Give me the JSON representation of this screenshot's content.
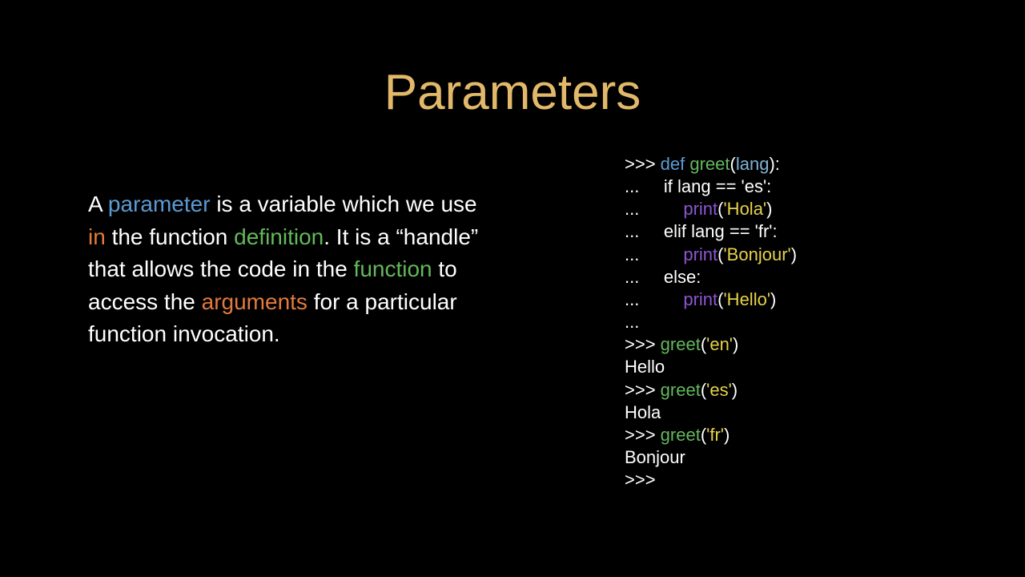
{
  "title": "Parameters",
  "body": {
    "t1": "A ",
    "t2": "parameter",
    "t3": " is a variable which we use ",
    "t4": "in",
    "t5": " the function ",
    "t6": "definition",
    "t7": ". It is a “handle” that allows the code in the ",
    "t8": "function",
    "t9": " to access the ",
    "t10": "arguments",
    "t11": " for a particular function invocation."
  },
  "code": {
    "l1p": ">>> ",
    "l1a": "def",
    "l1b": " greet",
    "l1c": "(",
    "l1d": "lang",
    "l1e": "):",
    "l2p": "...     ",
    "l2a": "if lang == 'es':",
    "l3p": "...         ",
    "l3a": "print",
    "l3b": "(",
    "l3c": "'Hola'",
    "l3d": ")",
    "l4p": "...     ",
    "l4a": "elif lang == 'fr':",
    "l5p": "...         ",
    "l5a": "print",
    "l5b": "(",
    "l5c": "'Bonjour'",
    "l5d": ")",
    "l6p": "...     ",
    "l6a": "else:",
    "l7p": "...         ",
    "l7a": "print",
    "l7b": "(",
    "l7c": "'Hello'",
    "l7d": ")",
    "l8p": "... ",
    "l9p": ">>> ",
    "l9a": "greet",
    "l9b": "(",
    "l9c": "'en'",
    "l9d": ")",
    "l10": "Hello",
    "l11p": ">>> ",
    "l11a": "greet",
    "l11b": "(",
    "l11c": "'es'",
    "l11d": ")",
    "l12": "Hola",
    "l13p": ">>> ",
    "l13a": "greet",
    "l13b": "(",
    "l13c": "'fr'",
    "l13d": ")",
    "l14": "Bonjour",
    "l15p": ">>> "
  },
  "colors": {
    "title": "#e2b96a",
    "blue": "#5b9bd5",
    "orange": "#e27b3c",
    "green": "#62b95a",
    "purple": "#8e55d1",
    "yellow": "#e6d24a",
    "lblue": "#7fb3d5",
    "white": "#ffffff",
    "bg": "#000000"
  }
}
